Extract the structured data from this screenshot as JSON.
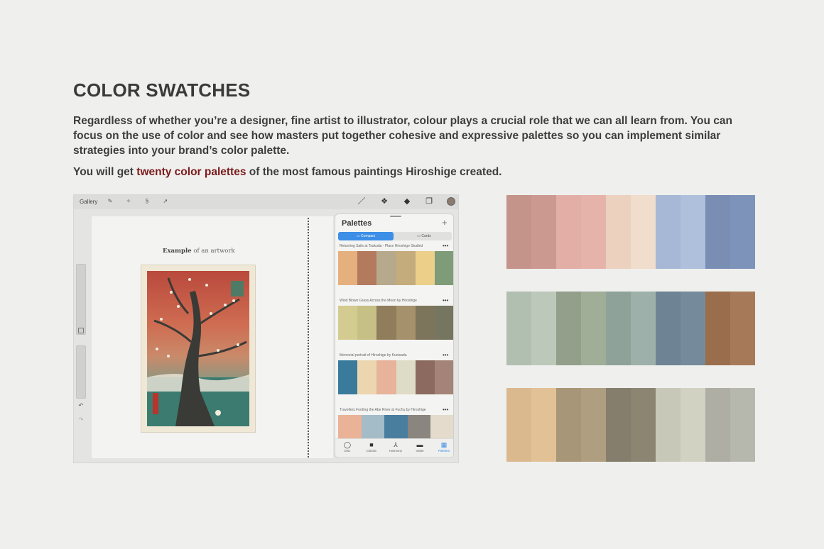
{
  "title": "COLOR SWATCHES",
  "intro": "Regardless of whether you’re a designer, fine artist to illustrator, colour plays a crucial role that we can all learn from. You can focus on the use of color and see how masters put together cohesive and expressive palettes so you can implement similar strategies into your brand’s color palette.",
  "tagline": {
    "before": "You will get ",
    "highlight": "twenty color palettes",
    "after": " of the most famous paintings Hiroshige created."
  },
  "app": {
    "gallery_label": "Gallery",
    "example": {
      "bold": "Example",
      "rest": " of an artwork"
    },
    "panel": {
      "title": "Palettes",
      "plus": "+",
      "tabs": {
        "compact": "Compact",
        "cards": "Cards"
      },
      "more": "•••",
      "palettes": [
        {
          "name": "Returning Sails at Tsukuda - Place Hiroshige Studied",
          "colors": [
            "#e6b07e",
            "#b47a5e",
            "#b7a98b",
            "#c4ac7c",
            "#ecd08a",
            "#7e9c78"
          ]
        },
        {
          "name": "Wind Blown Grass Across the Moon by Hiroshige",
          "colors": [
            "#d3cb90",
            "#c6bf86",
            "#8f7d5c",
            "#a5916c",
            "#7d745c",
            "#757560"
          ]
        },
        {
          "name": "Memorial portrait of Hiroshige by Kunisada",
          "colors": [
            "#3a7b9c",
            "#ecd6b0",
            "#e7b39a",
            "#dedbc7",
            "#8c6a60",
            "#a48478"
          ]
        },
        {
          "name": "Travellers Fording the Abe River at Fuchu by Hiroshige",
          "colors": [
            "#eab296",
            "#a4bcc8",
            "#4a7e9f",
            "#8a857f",
            "#e4dbcc"
          ]
        }
      ],
      "nav": [
        {
          "icon": "◯",
          "label": "Disc"
        },
        {
          "icon": "■",
          "label": "Classic"
        },
        {
          "icon": "⅄",
          "label": "Harmony"
        },
        {
          "icon": "▬",
          "label": "Value"
        },
        {
          "icon": "▦",
          "label": "Palettes"
        }
      ]
    }
  },
  "swatches": [
    [
      "#c4938a",
      "#cc9990",
      "#e3aea6",
      "#e6b3ab",
      "#ecd1bf",
      "#f0ddcb",
      "#a6b8d6",
      "#aec0dc",
      "#7a8eb4",
      "#7d93b9"
    ],
    [
      "#b1bfb1",
      "#bcc9ba",
      "#939f8b",
      "#a0ad97",
      "#8fa29a",
      "#9db1aa",
      "#6e8494",
      "#758b9c",
      "#9a6d4c",
      "#a67a58"
    ],
    [
      "#dbb98f",
      "#e2c197",
      "#a89678",
      "#b09e80",
      "#857e6c",
      "#8c8572",
      "#c8c8b8",
      "#d1d2c2",
      "#aeaea4",
      "#b7b8ad"
    ]
  ]
}
